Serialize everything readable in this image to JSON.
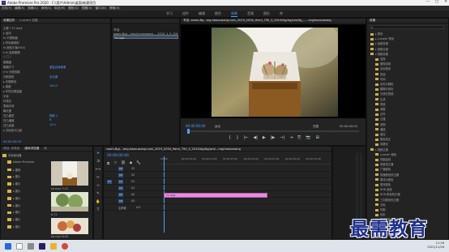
{
  "titlebar": {
    "title": "Adobe Premiere Pro 2020 - C:\\用户\\Admin\\桌面\\新建项目",
    "min": "—",
    "max": "□",
    "close": "✕"
  },
  "menu": [
    "文件(F)",
    "编辑(E)",
    "剪辑(C)",
    "序列(S)",
    "标记(M)",
    "图形(G)",
    "视图(V)",
    "窗口(W)",
    "帮助(H)"
  ],
  "workspaces": [
    "学习",
    "组件",
    "编辑",
    "颜色",
    "效果",
    "音频",
    "图形",
    "库"
  ],
  "workspace_active_index": 4,
  "effect_controls": {
    "tabs": [
      "效果控件",
      "Lumetri 范围"
    ],
    "rows": [
      "主要 * Y1.mp4",
      "▸ 运动",
      "fx 不透明度",
      "▸ 时间重映射",
      "fx 颜色平衡(HLS)",
      "▾ fx 高斯模糊",
      "○ □ ∕",
      "模糊度",
      "模糊尺寸",
      "▾ fx 光照效果",
      "光照类型",
      "▸ 光照颜色",
      "▸ 强度",
      "▸ 环境光照强度",
      "半径",
      "环境光",
      "表面光泽",
      "曝光度",
      "凹凸图层",
      "凹凸通道",
      "凹凸高度",
      "▸ 白色部分凸起"
    ],
    "values": [
      "",
      "",
      "",
      "",
      "",
      "",
      "",
      "",
      "重复边缘像素",
      "",
      "全光源",
      "",
      "100.0",
      "",
      "",
      "",
      "",
      "",
      "视频 1",
      "R",
      "10.0",
      ""
    ],
    "timecode": "00:00:00:00"
  },
  "source_monitor": {
    "clip_label": "节目: zoom,Bg(...)mp4,mxxuaom..._2019_1_5_3/4",
    "timecode": "00:00:00:00"
  },
  "program": {
    "title": "节目: zoom,Bg...mg,haosuwang.com_2019_2034_Hsmi_750_3_2019/Ag/Ag/pra/Ag_......mg/haosuwang",
    "timecode_left": "00:00:00:00",
    "fit": "适合",
    "quality": "完整",
    "timecode_right": "00:00:05:00",
    "buttons": [
      "{",
      "}",
      "|←",
      "◀|",
      "▶",
      "|▶",
      "→|",
      "⇥",
      "⎘",
      "📷",
      "⊞"
    ]
  },
  "project": {
    "tabs": [
      "项目: 未命名",
      "媒体浏览器",
      "库"
    ],
    "tree": [
      "本地驱动器",
      "Adobe Premiere",
      "▸ 图库",
      "▸ 图片",
      "▸ 图片",
      "▸ 图片",
      "▸ 图片",
      "▸ 图片",
      "▸ 图片",
      "▸ 图片",
      "▸ 图片"
    ],
    "file_labels": [
      "a0.mp4  5:23",
      "6,73",
      "Aa.mp4  6:09"
    ]
  },
  "timeline": {
    "title": "zoom,Bg(...)mg,haosuwang.com_2019_2034_Hsmi_750_3_2019/Ag/Ag/pra/...mg/haosuwang",
    "timecode": "00:00:00:00",
    "ruler": [
      "00:00",
      "00:00:05:00",
      "00:00:10:00",
      "00:00:15:00",
      "00:00:20:00",
      "00:00:25:00",
      "00:00:30:00",
      "00:00:35:00"
    ],
    "tracks": [
      "V3",
      "V2",
      "V1",
      "A1",
      "A2",
      "A3",
      "主声道"
    ],
    "master_value": "0.0",
    "clip_label": "Y1.mp4"
  },
  "effects": {
    "tab": "效果",
    "items": [
      "▸ 预设",
      "▸ Lumetri 预设",
      "▸ 音频效果",
      "▸ 音频过渡",
      "▾ 视频效果",
      "变换",
      "图像控制",
      "实用程序",
      "扭曲",
      "时间",
      "杂色与颗粒",
      "模糊与锐化",
      "沉浸式视频",
      "生成",
      "视频",
      "调整",
      "过时",
      "过渡",
      "透视",
      "通道",
      "键控",
      "颜色校正",
      "风格化",
      "▸ 视频过渡",
      "Lumetri 颜色",
      "亮度曲线",
      "亮度校正器",
      "广播颜色",
      "快速颜色校正器",
      "更改为颜色",
      "更改颜色",
      "RGB 曲线",
      "RGB 颜色校正器",
      "三向颜色校正器",
      "分色",
      "均衡",
      "色彩",
      "视频限制器",
      "通道混合器",
      "颜色平衡",
      "颜色平衡(HLS)"
    ]
  },
  "taskbar": {
    "time": "11:26",
    "date": "2021/11/26"
  },
  "watermark": "最需教育",
  "colors": {
    "accent": "#4ea1ff",
    "clip": "#e88be0",
    "panel": "#232323"
  }
}
